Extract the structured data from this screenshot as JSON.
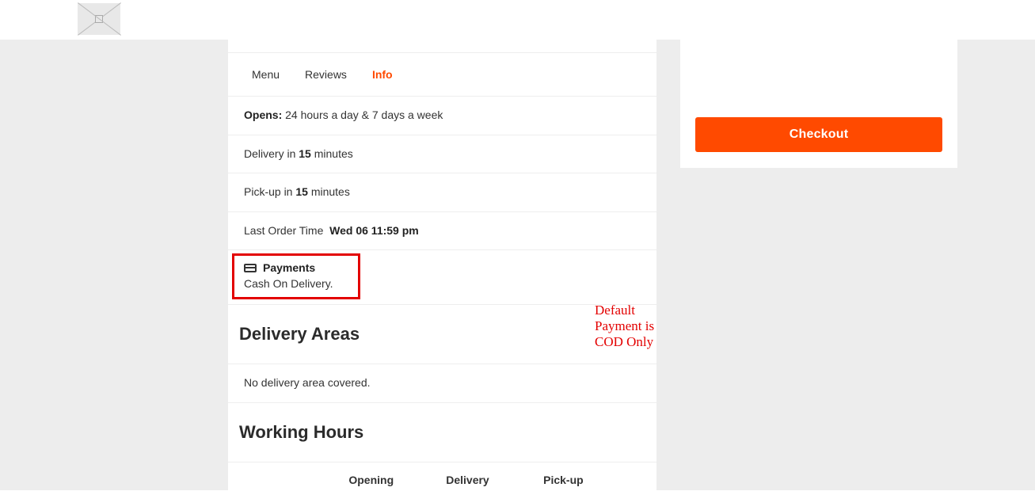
{
  "tabs": {
    "menu": "Menu",
    "reviews": "Reviews",
    "info": "Info"
  },
  "opens": {
    "label": "Opens:",
    "value": "24 hours a day & 7 days a week"
  },
  "delivery": {
    "prefix": "Delivery in ",
    "minutes": "15",
    "suffix": " minutes"
  },
  "pickup": {
    "prefix": "Pick-up in ",
    "minutes": "15",
    "suffix": " minutes"
  },
  "last_order": {
    "label": "Last Order Time",
    "value": "Wed 06 11:59 pm"
  },
  "payments": {
    "title": "Payments",
    "value": "Cash On Delivery."
  },
  "annotation": "Default Payment is COD Only",
  "delivery_areas": {
    "title": "Delivery Areas",
    "empty": "No delivery area covered."
  },
  "working_hours": {
    "title": "Working Hours",
    "cols": {
      "opening": "Opening",
      "delivery": "Delivery",
      "pickup": "Pick-up"
    }
  },
  "checkout": "Checkout"
}
